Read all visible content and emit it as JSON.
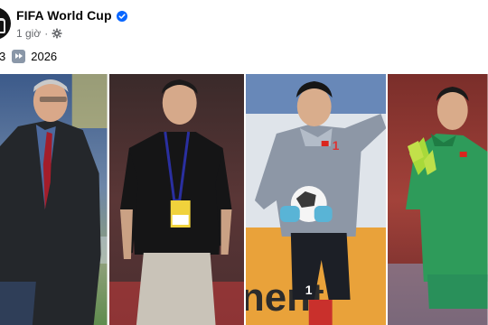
{
  "post": {
    "page_name": "FIFA World Cup",
    "time": "1 giờ",
    "separator": "·",
    "caption_prefix": "3",
    "caption_year": "2026"
  },
  "icons": {
    "avatar": "fifa-trophy-avatar",
    "verified": "verified-badge-icon",
    "privacy": "public-gear-icon",
    "arrow": "fast-forward-emoji-icon"
  },
  "colors": {
    "verified_blue": "#0866ff",
    "meta_gray": "#65676b",
    "vietnam_red": "#da251d",
    "gk_green": "#2e9b5a"
  },
  "photos": [
    {
      "alt": "Coach in black coat"
    },
    {
      "alt": "Coach in black shirt with lanyard"
    },
    {
      "alt": "Goalkeeper in grey kit holding ball"
    },
    {
      "alt": "Goalkeeper in green kit"
    }
  ]
}
